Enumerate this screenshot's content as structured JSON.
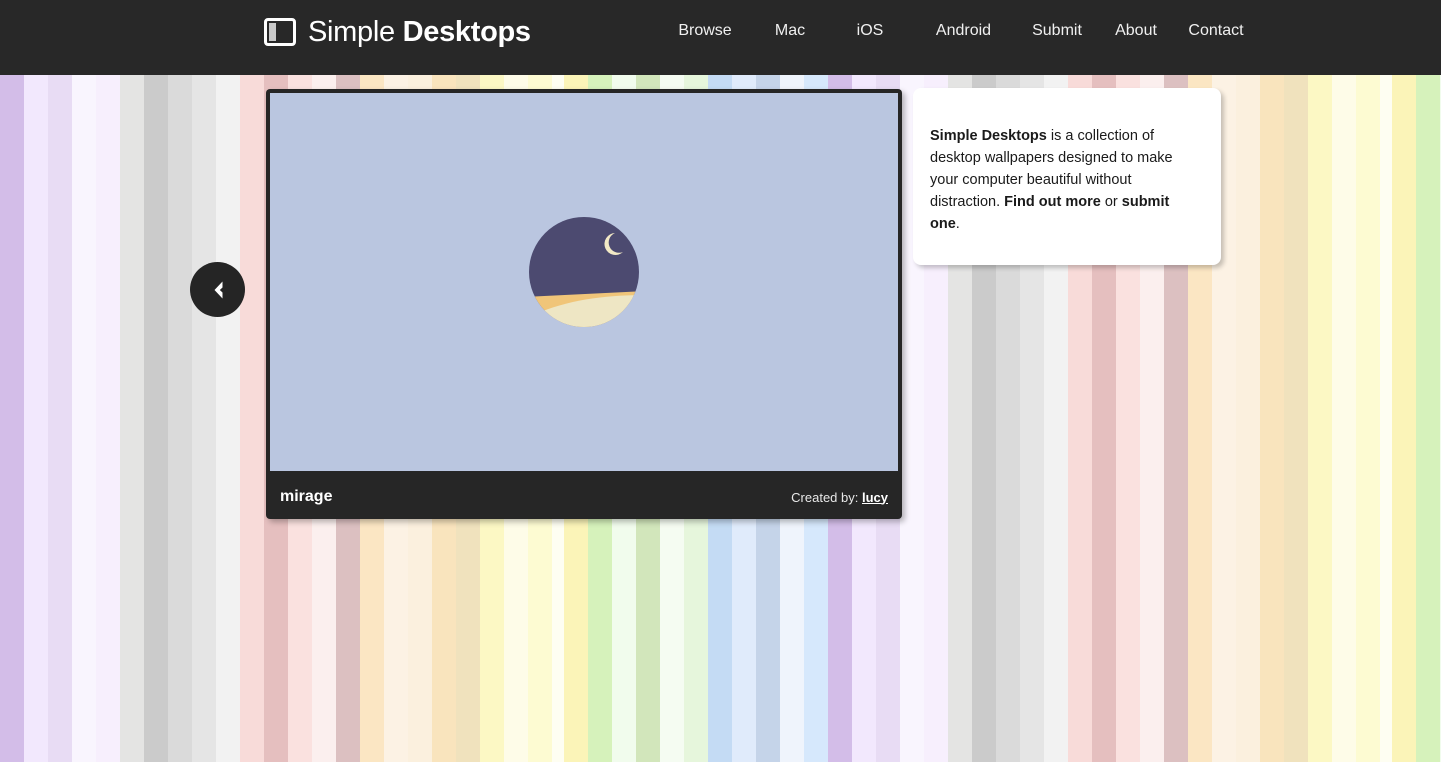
{
  "site": {
    "logo_light": "Simple ",
    "logo_bold": "Desktops",
    "logo_icon": "window-sidebar-icon"
  },
  "nav": {
    "items": [
      {
        "label": "Browse",
        "key": "browse"
      },
      {
        "label": "Mac",
        "key": "mac"
      },
      {
        "label": "iOS",
        "key": "ios"
      },
      {
        "label": "Android",
        "key": "android"
      },
      {
        "label": "Submit",
        "key": "submit"
      },
      {
        "label": "About",
        "key": "about"
      },
      {
        "label": "Contact",
        "key": "contact"
      }
    ]
  },
  "wallpaper": {
    "title": "mirage",
    "created_by_label": "Created by:",
    "author": "lucy",
    "art": {
      "sky_color": "#bac6e0",
      "night_color": "#4c4a70",
      "sand_color": "#eee6c4",
      "dune_color": "#f0c579",
      "moon": "crescent-moon-icon"
    }
  },
  "prev_button": {
    "icon": "chevron-left-icon",
    "label": "Previous"
  },
  "info": {
    "brand": "Simple Desktops",
    "line1_rest": " is a collection of",
    "line2": "desktop wallpapers designed to make your",
    "line3": "computer beautiful without distraction.",
    "find_out_more": "Find out more",
    "or_text": " or ",
    "submit_one": "submit one",
    "period": "."
  },
  "colors": {
    "header_bg": "#282828",
    "card_frame": "#262626",
    "panel_bg": "#ffffff",
    "text_light": "#f0f0f0"
  }
}
